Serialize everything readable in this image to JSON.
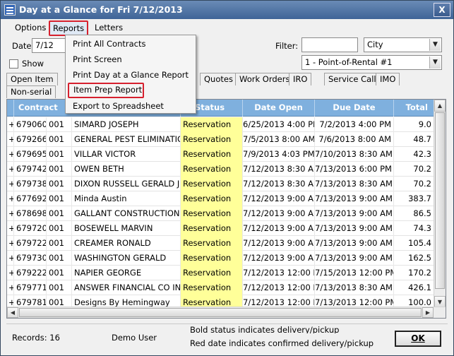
{
  "window": {
    "title": "Day at a Glance for Fri 7/12/2013",
    "close_label": "X"
  },
  "menubar": {
    "options": "Options",
    "reports": "Reports",
    "letters": "Letters"
  },
  "reports_menu": {
    "items": [
      "Print All Contracts",
      "Print Screen",
      "Print Day at a Glance Report",
      "Item Prep Report",
      "Export to Spreadsheet"
    ],
    "highlighted": "Item Prep Report"
  },
  "filters": {
    "date_label": "Date:",
    "date_value": "7/12",
    "show_label": "Show",
    "filter_label": "Filter:",
    "filter_value": "",
    "filter_field": "City",
    "store": "1 - Point-of-Rental #1"
  },
  "tabs": {
    "row1": [
      "Open Item",
      "Quotes",
      "Work Orders",
      "IRO",
      "Service Calls",
      "IMO"
    ],
    "row2": [
      "Non-serial"
    ]
  },
  "grid": {
    "headers": [
      "Contract",
      "Status",
      "Date Open",
      "Due Date",
      "Total"
    ],
    "rows": [
      {
        "expand": "+",
        "contract": "679060",
        "store": "001",
        "name": "SIMARD JOSEPH",
        "status": "Reservation",
        "open": "6/25/2013 4:00 PM",
        "due": "7/2/2013 4:00 PM",
        "total": "9.0"
      },
      {
        "expand": "+",
        "contract": "679266",
        "store": "001",
        "name": "GENERAL PEST ELIMINATION",
        "status": "Reservation",
        "open": "7/5/2013 8:00 AM",
        "due": "7/6/2013 8:00 AM",
        "total": "48.7"
      },
      {
        "expand": "+",
        "contract": "679695",
        "store": "001",
        "name": "VILLAR VICTOR",
        "status": "Reservation",
        "open": "7/9/2013 4:03 PM",
        "due": "7/10/2013 8:30 AM",
        "total": "42.3"
      },
      {
        "expand": "+",
        "contract": "679742",
        "store": "001",
        "name": "OWEN BETH",
        "status": "Reservation",
        "open": "7/12/2013 8:30 AM",
        "due": "7/13/2013 6:00 PM",
        "total": "70.2"
      },
      {
        "expand": "+",
        "contract": "679738",
        "store": "001",
        "name": "DIXON RUSSELL GERALD JR",
        "status": "Reservation",
        "open": "7/12/2013 8:30 AM",
        "due": "7/13/2013 8:30 AM",
        "total": "70.2"
      },
      {
        "expand": "+",
        "contract": "677692",
        "store": "001",
        "name": "Minda Austin",
        "status": "Reservation",
        "open": "7/12/2013 9:00 AM",
        "due": "7/13/2013 9:00 AM",
        "total": "383.7"
      },
      {
        "expand": "+",
        "contract": "678698",
        "store": "001",
        "name": "GALLANT CONSTRUCTION",
        "status": "Reservation",
        "open": "7/12/2013 9:00 AM",
        "due": "7/13/2013 9:00 AM",
        "total": "86.5"
      },
      {
        "expand": "+",
        "contract": "679720",
        "store": "001",
        "name": "BOSEWELL MARVIN",
        "status": "Reservation",
        "open": "7/12/2013 9:00 AM",
        "due": "7/13/2013 9:00 AM",
        "total": "74.3"
      },
      {
        "expand": "+",
        "contract": "679722",
        "store": "001",
        "name": "CREAMER RONALD",
        "status": "Reservation",
        "open": "7/12/2013 9:00 AM",
        "due": "7/13/2013 9:00 AM",
        "total": "105.4"
      },
      {
        "expand": "+",
        "contract": "679730",
        "store": "001",
        "name": "WASHINGTON GERALD",
        "status": "Reservation",
        "open": "7/12/2013 9:00 AM",
        "due": "7/13/2013 9:00 AM",
        "total": "162.5"
      },
      {
        "expand": "+",
        "contract": "679222",
        "store": "001",
        "name": "NAPIER GEORGE",
        "status": "Reservation",
        "open": "7/12/2013 12:00 PM",
        "due": "7/15/2013 12:00 PM",
        "total": "170.2"
      },
      {
        "expand": "+",
        "contract": "679771",
        "store": "001",
        "name": "ANSWER FINANCIAL CO INC",
        "status": "Reservation",
        "open": "7/12/2013 12:00 PM",
        "due": "7/13/2013 8:30 AM",
        "total": "426.1"
      },
      {
        "expand": "+",
        "contract": "679781",
        "store": "001",
        "name": "Designs By Hemingway",
        "status": "Reservation",
        "open": "7/12/2013 12:00 PM",
        "due": "7/13/2013 12:00 PM",
        "total": "100.0"
      }
    ]
  },
  "statusbar": {
    "records": "Records: 16",
    "user": "Demo User",
    "legend1": "Bold status indicates delivery/pickup",
    "legend2": "Red date indicates confirmed delivery/pickup",
    "ok": "OK"
  },
  "colors": {
    "header_bg": "#7fb0de",
    "status_bg": "#ffff99",
    "highlight_border": "#d6202e"
  }
}
